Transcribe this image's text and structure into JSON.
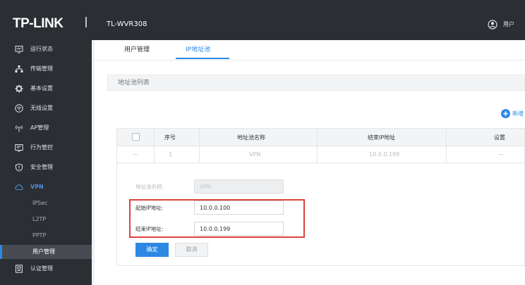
{
  "header": {
    "brand": "TP-LINK",
    "model": "TL-WVR308",
    "user_label": "用户"
  },
  "sidebar": {
    "items": [
      {
        "label": "运行状态",
        "icon": "monitor-icon"
      },
      {
        "label": "传输管理",
        "icon": "network-tree-icon"
      },
      {
        "label": "基本设置",
        "icon": "gear-icon"
      },
      {
        "label": "无线设置",
        "icon": "wifi-icon"
      },
      {
        "label": "AP管理",
        "icon": "antenna-icon"
      },
      {
        "label": "行为管控",
        "icon": "behavior-control-icon"
      },
      {
        "label": "安全管理",
        "icon": "shield-icon"
      },
      {
        "label": "VPN",
        "icon": "cloud-icon"
      }
    ],
    "vpn_subitems": [
      {
        "label": "IPSec"
      },
      {
        "label": "L2TP"
      },
      {
        "label": "PPTP"
      },
      {
        "label": "用户管理"
      }
    ],
    "after_items": [
      {
        "label": "认证管理",
        "icon": "auth-icon"
      }
    ]
  },
  "tabs": [
    {
      "label": "用户管理"
    },
    {
      "label": "IP地址池"
    }
  ],
  "section": {
    "title": "地址池列表"
  },
  "toolbar": {
    "add_label": "新增"
  },
  "table": {
    "columns": [
      "序号",
      "地址池名称",
      "结束IP地址",
      "设置"
    ],
    "rows": [
      {
        "index": "1",
        "name": "VPN",
        "end_ip": "10.0.0.199",
        "settings": "—"
      }
    ]
  },
  "edit_form": {
    "pool_name_label": "地址池名称:",
    "pool_name_value": "VPN",
    "start_ip_label": "起始IP地址:",
    "start_ip_value": "10.0.0.100",
    "end_ip_label": "结束IP地址:",
    "end_ip_value": "10.0.0.199",
    "confirm_label": "确定",
    "cancel_label": "取消"
  },
  "colors": {
    "accent": "#2d88e3",
    "sidebar_bg": "#2b2e33",
    "highlight": "#d9433c"
  }
}
